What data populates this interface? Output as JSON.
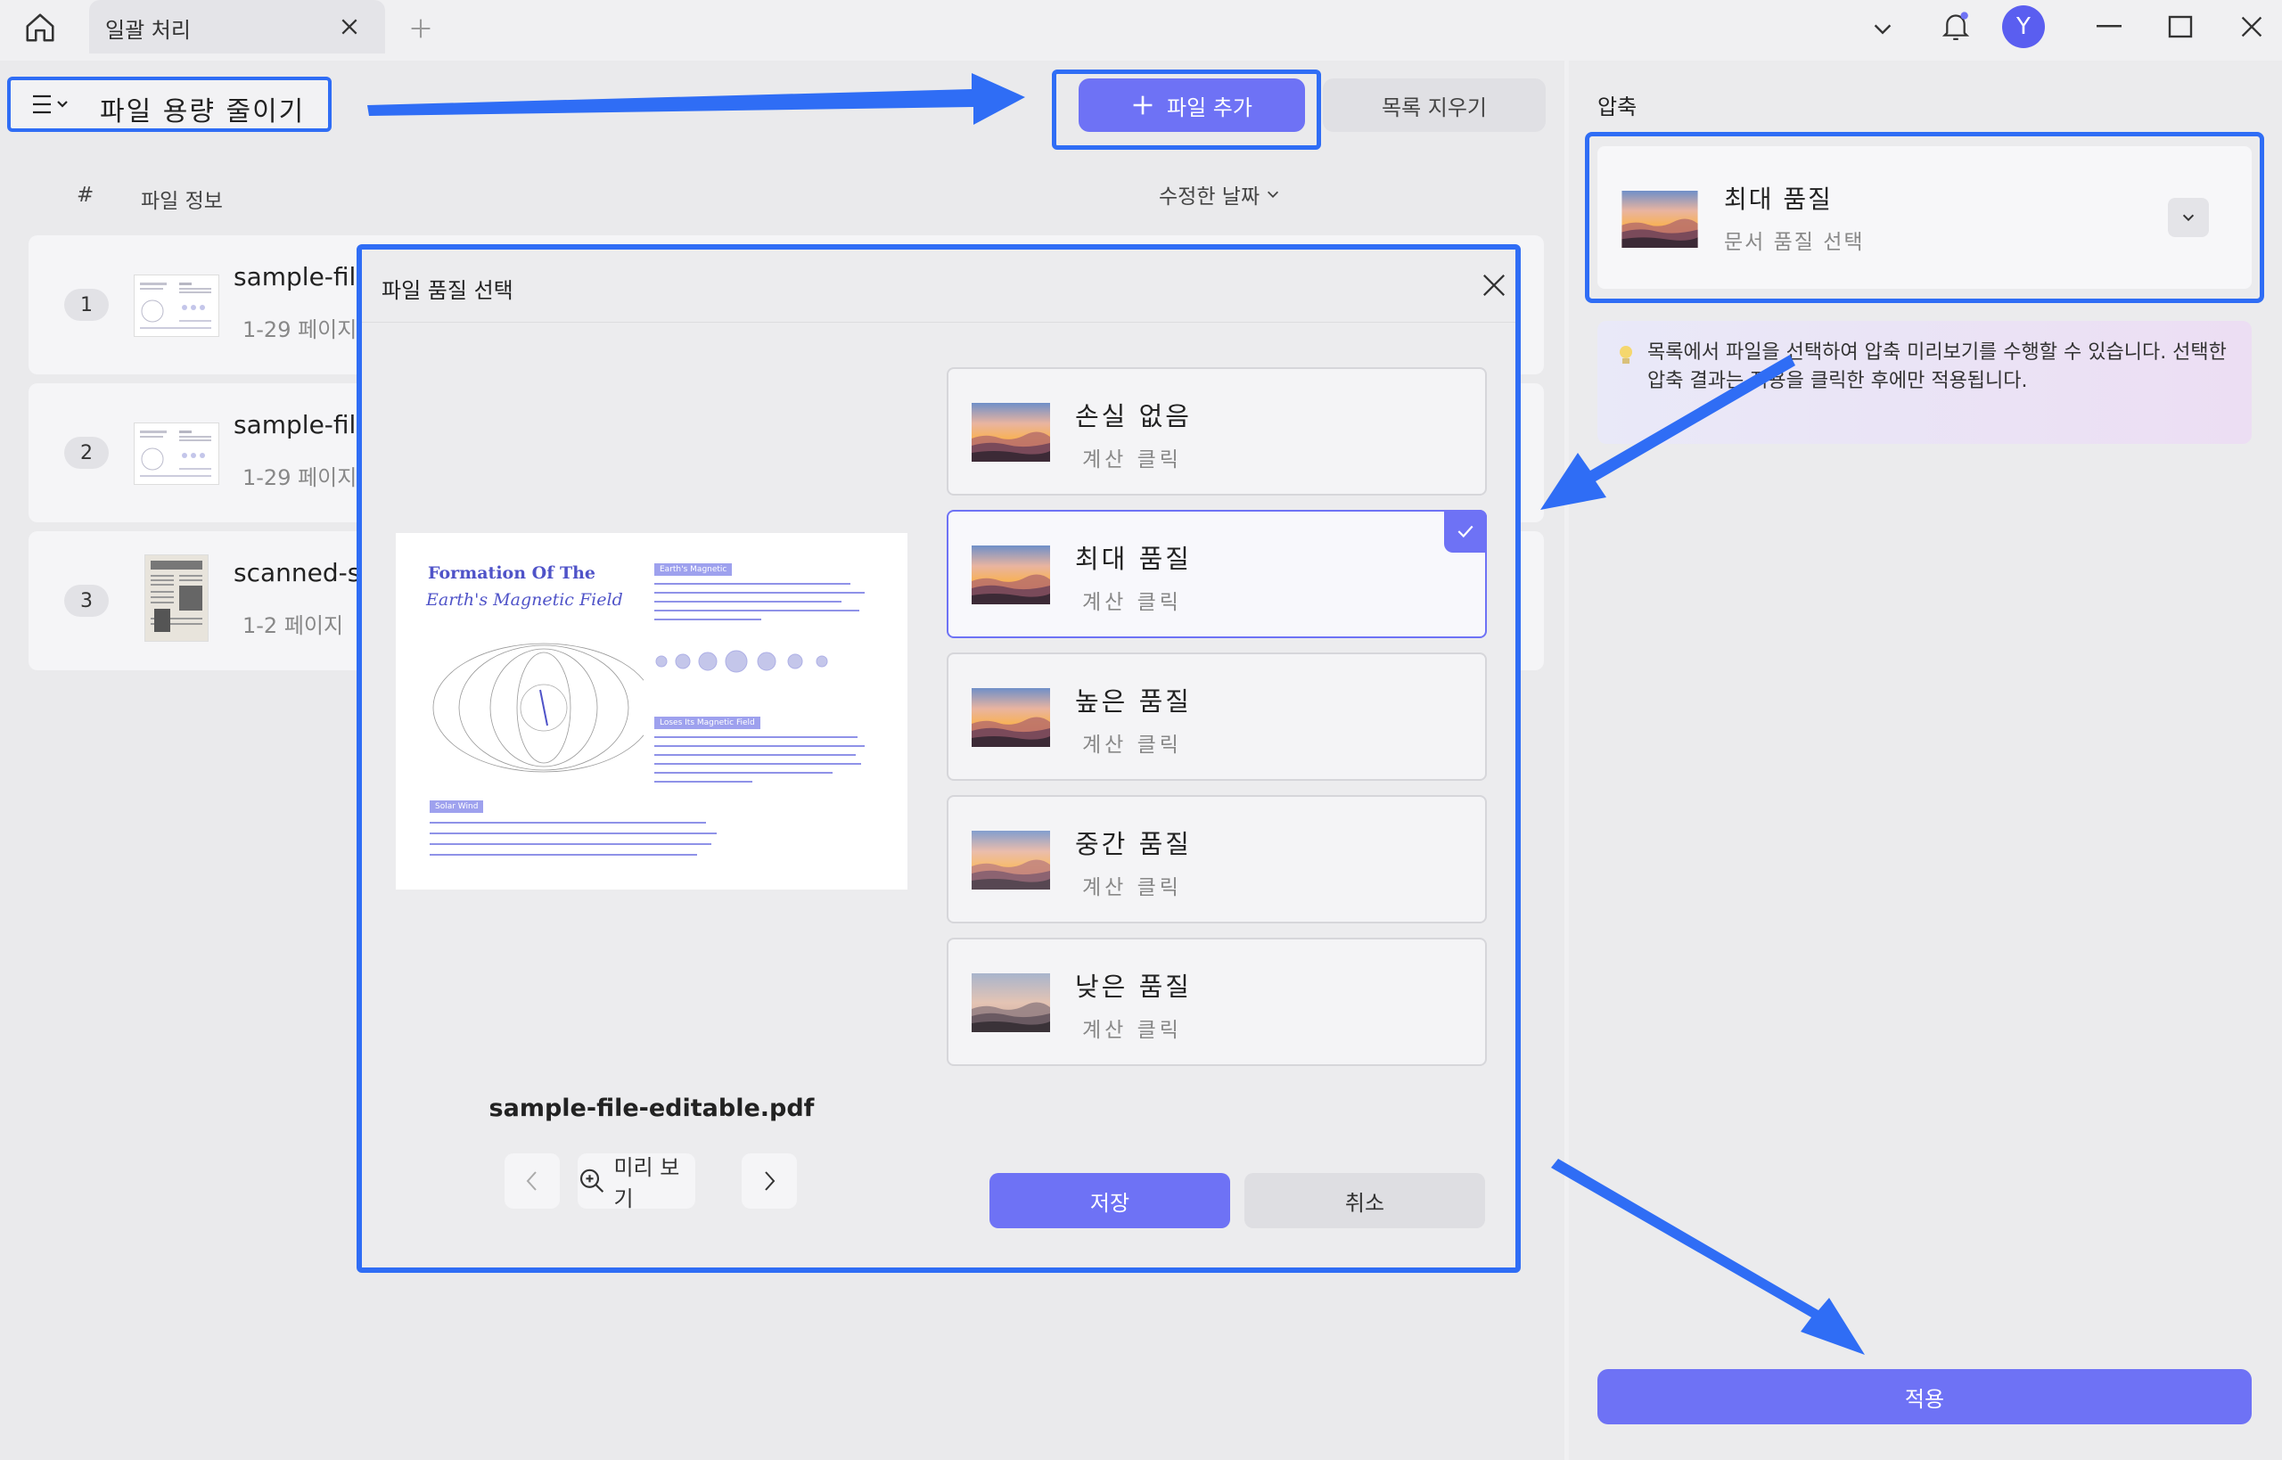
{
  "titlebar": {
    "tab_label": "일괄 처리",
    "avatar_letter": "Y"
  },
  "toolbar": {
    "menu_label": "파일 용량 줄이기",
    "add_file_label": "파일 추가",
    "clear_list_label": "목록 지우기"
  },
  "file_list": {
    "columns": [
      "#",
      "파일 정보",
      "수정한 날짜"
    ],
    "items": [
      {
        "index": "1",
        "name": "sample-file",
        "pages": "1-29 페이지"
      },
      {
        "index": "2",
        "name": "sample-file",
        "pages": "1-29 페이지"
      },
      {
        "index": "3",
        "name": "scanned-sa",
        "pages": "1-2 페이지"
      }
    ]
  },
  "dialog": {
    "title": "파일 품질 선택",
    "preview": {
      "heading_line1": "Formation Of The",
      "heading_line2": "Earth's Magnetic Field",
      "tag1": "Earth's Magnetic",
      "tag2": "Loses Its Magnetic Field",
      "tag3": "Solar Wind"
    },
    "file_name": "sample-file-editable.pdf",
    "preview_button_label": "미리 보기",
    "options": [
      {
        "title": "손실 없음",
        "subtitle": "계산 클릭",
        "selected": false
      },
      {
        "title": "최대 품질",
        "subtitle": "계산 클릭",
        "selected": true
      },
      {
        "title": "높은 품질",
        "subtitle": "계산 클릭",
        "selected": false
      },
      {
        "title": "중간 품질",
        "subtitle": "계산 클릭",
        "selected": false
      },
      {
        "title": "낮은 품질",
        "subtitle": "계산 클릭",
        "selected": false
      }
    ],
    "save_label": "저장",
    "cancel_label": "취소"
  },
  "compress_panel": {
    "title": "압축",
    "quality_title": "최대 품질",
    "quality_subtitle": "문서 품질 선택",
    "tip": "목록에서 파일을 선택하여 압축 미리보기를 수행할 수 있습니다. 선택한 압축 결과는 적용을 클릭한 후에만 적용됩니다.",
    "apply_label": "적용"
  },
  "colors": {
    "accent": "#6e72f5",
    "highlight": "#2f6df5"
  }
}
